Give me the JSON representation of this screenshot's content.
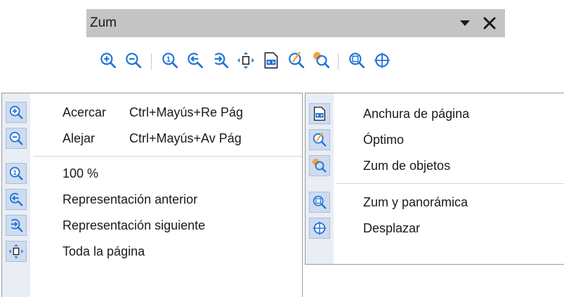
{
  "toolbar": {
    "title": "Zum",
    "icons": [
      "zoom-in-icon",
      "zoom-out-icon",
      "zoom-100-icon",
      "previous-view-icon",
      "next-view-icon",
      "entire-page-icon",
      "page-width-icon",
      "optimal-icon",
      "zoom-objects-icon",
      "zoom-pan-icon",
      "shift-icon"
    ]
  },
  "menu_left": {
    "items": [
      {
        "label": "Acercar",
        "shortcut": "Ctrl+Mayús+Re Pág",
        "icon": "zoom-in-icon"
      },
      {
        "label": "Alejar",
        "shortcut": "Ctrl+Mayús+Av Pág",
        "icon": "zoom-out-icon"
      },
      {
        "label": "100 %",
        "icon": "zoom-100-icon"
      },
      {
        "label": "Representación anterior",
        "icon": "previous-view-icon"
      },
      {
        "label": "Representación siguiente",
        "icon": "next-view-icon"
      },
      {
        "label": "Toda la página",
        "icon": "entire-page-icon"
      }
    ]
  },
  "menu_right": {
    "items": [
      {
        "label": "Anchura de página",
        "icon": "page-width-icon"
      },
      {
        "label": "Óptimo",
        "icon": "optimal-icon"
      },
      {
        "label": "Zum de objetos",
        "icon": "zoom-objects-icon"
      },
      {
        "label": "Zum y panorámica",
        "icon": "zoom-pan-icon"
      },
      {
        "label": "Desplazar",
        "icon": "shift-icon"
      }
    ]
  },
  "colors": {
    "accent": "#1e73d8",
    "title_bar": "#c4c4c4",
    "icon_highlight": "#cfdcef",
    "orange": "#f5a33a"
  }
}
